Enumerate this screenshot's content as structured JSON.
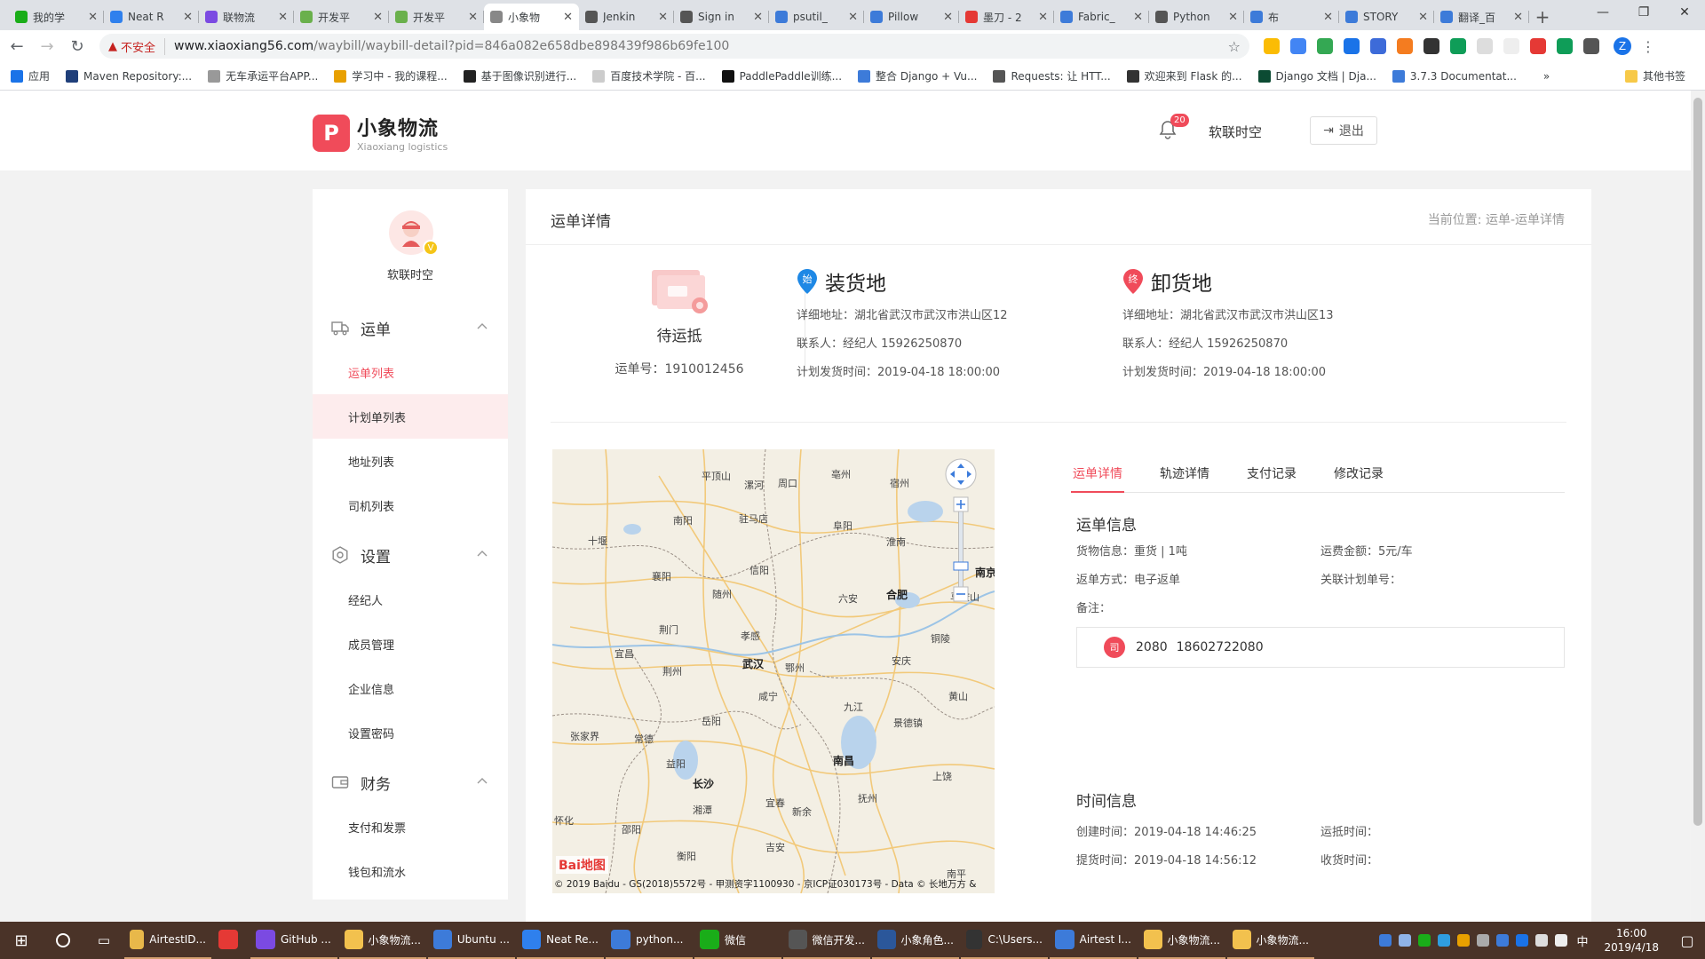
{
  "browser": {
    "tabs": [
      {
        "title": "我的学",
        "color": "#1aad19"
      },
      {
        "title": "Neat R",
        "color": "#2f80ed"
      },
      {
        "title": "联物流",
        "color": "#7b4ae2"
      },
      {
        "title": "开发平",
        "color": "#6ab04c"
      },
      {
        "title": "开发平",
        "color": "#6ab04c"
      },
      {
        "title": "小象物",
        "color": "#888888",
        "active": true
      },
      {
        "title": "Jenkin",
        "color": "#555555"
      },
      {
        "title": "Sign in",
        "color": "#555555"
      },
      {
        "title": "psutil_",
        "color": "#3d7bd9"
      },
      {
        "title": "Pillow",
        "color": "#3d7bd9"
      },
      {
        "title": "墨刀 - 2",
        "color": "#e53935"
      },
      {
        "title": "Fabric_",
        "color": "#3d7bd9"
      },
      {
        "title": "Python",
        "color": "#555555"
      },
      {
        "title": "布",
        "color": "#3d7bd9"
      },
      {
        "title": "STORY",
        "color": "#3d7bd9"
      },
      {
        "title": "翻译_百",
        "color": "#3d7bd9"
      }
    ],
    "url_host": "www.xiaoxiang56.com",
    "url_path": "/waybill/waybill-detail?pid=846a082e658dbe898439f986b69fe100",
    "insecure_label": "不安全",
    "profile_initial": "Z",
    "bookmarks": [
      {
        "label": "应用",
        "color": "#1a73e8"
      },
      {
        "label": "Maven Repository:...",
        "color": "#1f3f7a"
      },
      {
        "label": "无车承运平台APP...",
        "color": "#999999"
      },
      {
        "label": "学习中 - 我的课程...",
        "color": "#e8a000"
      },
      {
        "label": "基于图像识别进行...",
        "color": "#222222"
      },
      {
        "label": "百度技术学院 - 百...",
        "color": "#cccccc"
      },
      {
        "label": "PaddlePaddle训练...",
        "color": "#111111"
      },
      {
        "label": "整合 Django + Vu...",
        "color": "#3d7bd9"
      },
      {
        "label": "Requests: 让 HTT...",
        "color": "#555555"
      },
      {
        "label": "欢迎来到 Flask 的...",
        "color": "#333333"
      },
      {
        "label": "Django 文档 | Dja...",
        "color": "#0c4b33"
      },
      {
        "label": "3.7.3 Documentat...",
        "color": "#3d7bd9"
      }
    ],
    "bookmarks_other": "其他书签"
  },
  "header": {
    "logo_mark": "P",
    "logo_cn": "小象物流",
    "logo_en": "Xiaoxiang logistics",
    "notif_count": "20",
    "user": "软联时空",
    "logout": "退出"
  },
  "sidebar": {
    "user": "软联时空",
    "verified": "V",
    "groups": [
      {
        "label": "运单",
        "items": [
          "运单列表",
          "计划单列表",
          "地址列表",
          "司机列表"
        ]
      },
      {
        "label": "设置",
        "items": [
          "经纪人",
          "成员管理",
          "企业信息",
          "设置密码"
        ]
      },
      {
        "label": "财务",
        "items": [
          "支付和发票",
          "钱包和流水"
        ]
      }
    ]
  },
  "detail": {
    "title": "运单详情",
    "breadcrumb": "当前位置: 运单-运单详情",
    "status": "待运抵",
    "waybill_no": "运单号：1910012456",
    "origin": {
      "badge": "始",
      "title": "装货地",
      "address": "详细地址：湖北省武汉市武汉市洪山区12",
      "contact": "联系人：经纪人 15926250870",
      "time": "计划发货时间：2019-04-18 18:00:00"
    },
    "dest": {
      "badge": "终",
      "title": "卸货地",
      "address": "详细地址：湖北省武汉市武汉市洪山区13",
      "contact": "联系人：经纪人 15926250870",
      "time": "计划发货时间：2019-04-18 18:00:00"
    },
    "tabs": [
      "运单详情",
      "轨迹详情",
      "支付记录",
      "修改记录"
    ],
    "waybill_info": {
      "title": "运单信息",
      "cargo": "货物信息：重货 | 1吨",
      "freight": "运费金额：5元/车",
      "return_method": "返单方式：电子返单",
      "plan_no": "关联计划单号：",
      "remark": "备注："
    },
    "driver": {
      "badge": "司",
      "name": "2080",
      "phone": "18602722080"
    },
    "time_info": {
      "title": "时间信息",
      "created": "创建时间：2019-04-18 14:46:25",
      "arrive": "运抵时间：",
      "pickup": "提货时间：2019-04-18 14:56:12",
      "receive": "收货时间："
    }
  },
  "map": {
    "logo": "Bai地图",
    "copyright": "© 2019 Baidu - GS(2018)5572号 - 甲测资字1100930 - 京ICP证030173号 - Data © 长地万方 &",
    "labels": [
      {
        "text": "武汉",
        "big": true
      },
      {
        "text": "合肥",
        "big": true
      },
      {
        "text": "南昌",
        "big": true
      },
      {
        "text": "长沙",
        "big": true
      },
      {
        "text": "南京",
        "big": true
      },
      {
        "text": "平顶山"
      },
      {
        "text": "漯河"
      },
      {
        "text": "周口"
      },
      {
        "text": "亳州"
      },
      {
        "text": "宿州"
      },
      {
        "text": "南阳"
      },
      {
        "text": "驻马店"
      },
      {
        "text": "阜阳"
      },
      {
        "text": "淮南"
      },
      {
        "text": "十堰"
      },
      {
        "text": "信阳"
      },
      {
        "text": "六安"
      },
      {
        "text": "襄阳"
      },
      {
        "text": "随州"
      },
      {
        "text": "马鞍山"
      },
      {
        "text": "荆门"
      },
      {
        "text": "孝感"
      },
      {
        "text": "安庆"
      },
      {
        "text": "铜陵"
      },
      {
        "text": "宜昌"
      },
      {
        "text": "荆州"
      },
      {
        "text": "鄂州"
      },
      {
        "text": "黄山"
      },
      {
        "text": "咸宁"
      },
      {
        "text": "九江"
      },
      {
        "text": "景德镇"
      },
      {
        "text": "岳阳"
      },
      {
        "text": "常德"
      },
      {
        "text": "张家界"
      },
      {
        "text": "益阳"
      },
      {
        "text": "湘潭"
      },
      {
        "text": "宜春"
      },
      {
        "text": "新余"
      },
      {
        "text": "抚州"
      },
      {
        "text": "上饶"
      },
      {
        "text": "邵阳"
      },
      {
        "text": "吉安"
      },
      {
        "text": "衡阳"
      },
      {
        "text": "南平"
      },
      {
        "text": "怀化"
      }
    ]
  },
  "taskbar": {
    "apps": [
      {
        "label": "AirtestID...",
        "color": "#e8b84a"
      },
      {
        "label": "",
        "color": "#e53935"
      },
      {
        "label": "GitHub ...",
        "color": "#7b4ae2"
      },
      {
        "label": "小象物流...",
        "color": "#f2c14e"
      },
      {
        "label": "Ubuntu ...",
        "color": "#3d7bd9"
      },
      {
        "label": "Neat Re...",
        "color": "#2f80ed"
      },
      {
        "label": "python...",
        "color": "#3d7bd9"
      },
      {
        "label": "微信",
        "color": "#1aad19"
      },
      {
        "label": "微信开发...",
        "color": "#555555"
      },
      {
        "label": "小象角色...",
        "color": "#2b579a"
      },
      {
        "label": "C:\\Users...",
        "color": "#333333"
      },
      {
        "label": "Airtest I...",
        "color": "#3d7bd9"
      },
      {
        "label": "小象物流...",
        "color": "#f2c14e"
      },
      {
        "label": "小象物流...",
        "color": "#f2c14e"
      }
    ],
    "ime": "中",
    "time": "16:00",
    "date": "2019/4/18"
  }
}
